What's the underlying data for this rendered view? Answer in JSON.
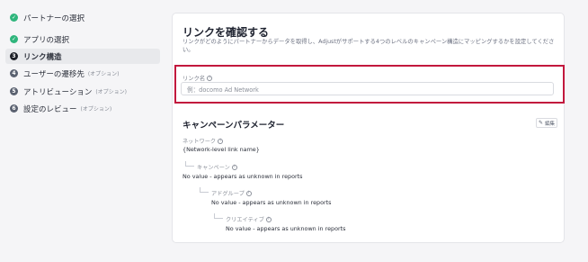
{
  "sidebar": {
    "steps": [
      {
        "label": "パートナーの選択",
        "status": "done",
        "marker": "✓",
        "optional": ""
      },
      {
        "label": "アプリの選択",
        "status": "done",
        "marker": "✓",
        "optional": ""
      },
      {
        "label": "リンク構造",
        "status": "active",
        "marker": "3",
        "optional": ""
      },
      {
        "label": "ユーザーの遷移先",
        "status": "todo",
        "marker": "4",
        "optional": "(オプション)"
      },
      {
        "label": "アトリビューション",
        "status": "todo",
        "marker": "5",
        "optional": "(オプション)"
      },
      {
        "label": "設定のレビュー",
        "status": "todo",
        "marker": "6",
        "optional": "(オプション)"
      }
    ]
  },
  "main": {
    "title": "リンクを確認する",
    "description": "リンクがどのようにパートナーからデータを取得し、Adjustがサポートする4つのレベルのキャンペーン構造にマッピングするかを設定してください。",
    "link_name": {
      "label": "リンク名",
      "placeholder": "例：docomo Ad Network",
      "value": ""
    },
    "campaign_params": {
      "title": "キャンペーンパラメーター",
      "edit_label": "編集",
      "network": {
        "label": "ネットワーク",
        "value": "{Network-level link name}"
      },
      "campaign": {
        "label": "キャンペーン",
        "value": "No value - appears as unknown in reports"
      },
      "adgroup": {
        "label": "アドグループ",
        "value": "No value - appears as unknown in reports"
      },
      "creative": {
        "label": "クリエイティブ",
        "value": "No value - appears as unknown in reports"
      }
    }
  },
  "colors": {
    "done": "#2fb57c",
    "highlight": "#c2183d",
    "background": "#f5f5f7"
  }
}
